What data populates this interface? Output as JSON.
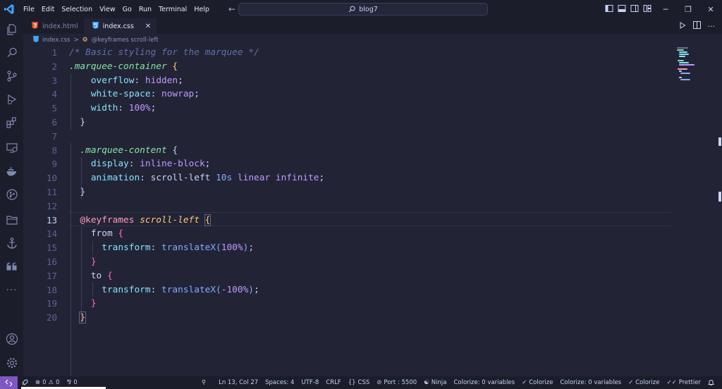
{
  "titlebar": {
    "menu": [
      "File",
      "Edit",
      "Selection",
      "View",
      "Go",
      "Run",
      "Terminal",
      "Help"
    ],
    "search_text": "blog7"
  },
  "tabs": [
    {
      "label": "index.html",
      "icon": "html-file-icon",
      "active": false
    },
    {
      "label": "index.css",
      "icon": "css-file-icon",
      "active": true
    }
  ],
  "breadcrumb": {
    "file": "index.css",
    "separator": ">",
    "symbol": "@keyframes scroll-left"
  },
  "editor": {
    "line_numbers": [
      "1",
      "2",
      "3",
      "4",
      "5",
      "6",
      "7",
      "8",
      "9",
      "10",
      "11",
      "12",
      "13",
      "14",
      "15",
      "16",
      "17",
      "18",
      "19",
      "20"
    ],
    "current_line": 13
  },
  "statusbar": {
    "errors": "0",
    "warnings": "0",
    "ports": "0",
    "cursor": "Ln 13, Col 27",
    "spaces": "Spaces: 4",
    "encoding": "UTF-8",
    "eol": "CRLF",
    "language": "CSS",
    "port": "Port : 5500",
    "ninja": "Ninja",
    "colorize_vars_1": "Colorize: 0 variables",
    "colorize_1": "Colorize",
    "colorize_vars_2": "Colorize: 0 variables",
    "colorize_2": "Colorize",
    "prettier": "Prettier"
  },
  "colors": {
    "accent": "#7e57c2",
    "editor_bg": "#222436",
    "chrome_bg": "#1b1d2b"
  }
}
